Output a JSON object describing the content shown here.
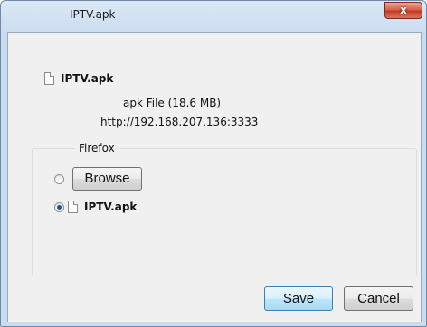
{
  "dialog": {
    "title": "IPTV.apk",
    "close_label": "x"
  },
  "file": {
    "name": "IPTV.apk",
    "type_size": "apk File (18.6 MB)",
    "source": "http://192.168.207.136:3333"
  },
  "group": {
    "label": "Firefox",
    "browse_label": "Browse",
    "selected_file": "IPTV.apk"
  },
  "buttons": {
    "save": "Save",
    "cancel": "Cancel"
  }
}
